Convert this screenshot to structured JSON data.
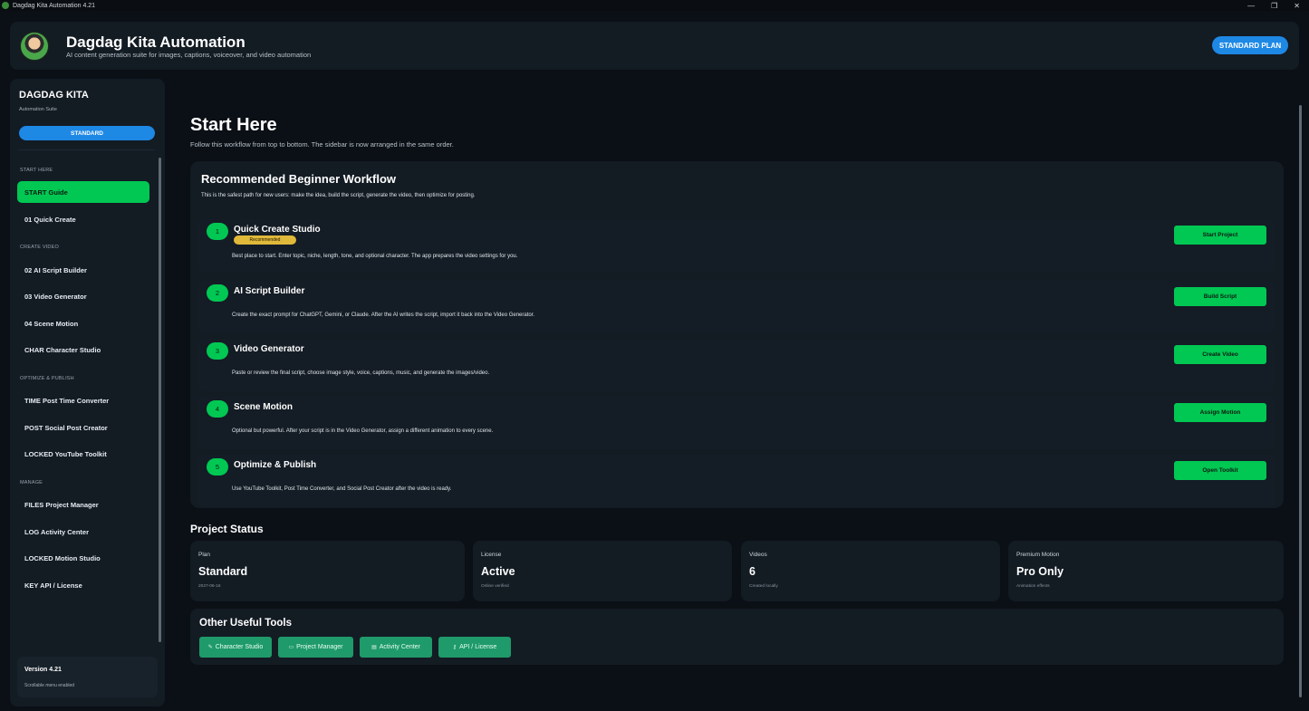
{
  "window": {
    "title": "Dagdag Kita Automation 4.21",
    "controls": [
      "—",
      "❐",
      "✕"
    ]
  },
  "header": {
    "title": "Dagdag Kita Automation",
    "subtitle": "AI content generation suite for images, captions, voiceover, and video automation",
    "plan_button": "STANDARD PLAN"
  },
  "sidebar": {
    "brand": "DAGDAG KITA",
    "brand_sub": "Automation Suite",
    "plan": "STANDARD",
    "sections": {
      "start": "START HERE",
      "create": "CREATE VIDEO",
      "optimize": "OPTIMIZE & PUBLISH",
      "manage": "MANAGE"
    },
    "items": [
      {
        "label": "START  Guide"
      },
      {
        "label": "01  Quick Create"
      },
      {
        "label": "02  AI Script Builder"
      },
      {
        "label": "03  Video Generator"
      },
      {
        "label": "04  Scene Motion"
      },
      {
        "label": "CHAR  Character Studio"
      },
      {
        "label": "TIME  Post Time Converter"
      },
      {
        "label": "POST  Social Post Creator"
      },
      {
        "label": "LOCKED  YouTube Toolkit"
      },
      {
        "label": "FILES  Project Manager"
      },
      {
        "label": "LOG  Activity Center"
      },
      {
        "label": "LOCKED  Motion Studio"
      },
      {
        "label": "KEY  API / License"
      }
    ],
    "footer": {
      "version": "Version 4.21",
      "note": "Scrollable menu enabled"
    }
  },
  "main": {
    "title": "Start Here",
    "subtitle": "Follow this workflow from top to bottom. The sidebar is now arranged in the same order.",
    "workflow": {
      "title": "Recommended Beginner Workflow",
      "subtitle": "This is the safest path for new users: make the idea, build the script, generate the video, then optimize for posting.",
      "steps": [
        {
          "num": "1",
          "title": "Quick Create Studio",
          "badge": "Recommended",
          "desc": "Best place to start. Enter topic, niche, length, tone, and optional character. The app prepares the video settings for you.",
          "button": "Start Project"
        },
        {
          "num": "2",
          "title": "AI Script Builder",
          "desc": "Create the exact prompt for ChatGPT, Gemini, or Claude. After the AI writes the script, import it back into the Video Generator.",
          "button": "Build Script"
        },
        {
          "num": "3",
          "title": "Video Generator",
          "desc": "Paste or review the final script, choose image style, voice, captions, music, and generate the images/video.",
          "button": "Create Video"
        },
        {
          "num": "4",
          "title": "Scene Motion",
          "desc": "Optional but powerful. After your script is in the Video Generator, assign a different animation to every scene.",
          "button": "Assign Motion"
        },
        {
          "num": "5",
          "title": "Optimize & Publish",
          "desc": "Use YouTube Toolkit, Post Time Converter, and Social Post Creator after the video is ready.",
          "button": "Open Toolkit"
        }
      ]
    },
    "status": {
      "title": "Project Status",
      "cards": [
        {
          "label": "Plan",
          "value": "Standard",
          "sub": "2027-06-16"
        },
        {
          "label": "License",
          "value": "Active",
          "sub": "Online verified"
        },
        {
          "label": "Videos",
          "value": "6",
          "sub": "Created locally"
        },
        {
          "label": "Premium Motion",
          "value": "Pro Only",
          "sub": "Animation effects"
        }
      ]
    },
    "tools": {
      "title": "Other Useful Tools",
      "buttons": [
        {
          "icon": "character-icon",
          "glyph": "✎",
          "label": "Character Studio"
        },
        {
          "icon": "folder-icon",
          "glyph": "▭",
          "label": "Project Manager"
        },
        {
          "icon": "log-icon",
          "glyph": "▤",
          "label": "Activity Center"
        },
        {
          "icon": "key-icon",
          "glyph": "⚷",
          "label": "API / License"
        }
      ]
    }
  },
  "colors": {
    "accent_green": "#00c853",
    "accent_blue": "#1e88e5",
    "badge_yellow": "#e0b83a",
    "tool_green": "#1f9a6a",
    "panel": "#131b23",
    "background": "#0b1016"
  }
}
